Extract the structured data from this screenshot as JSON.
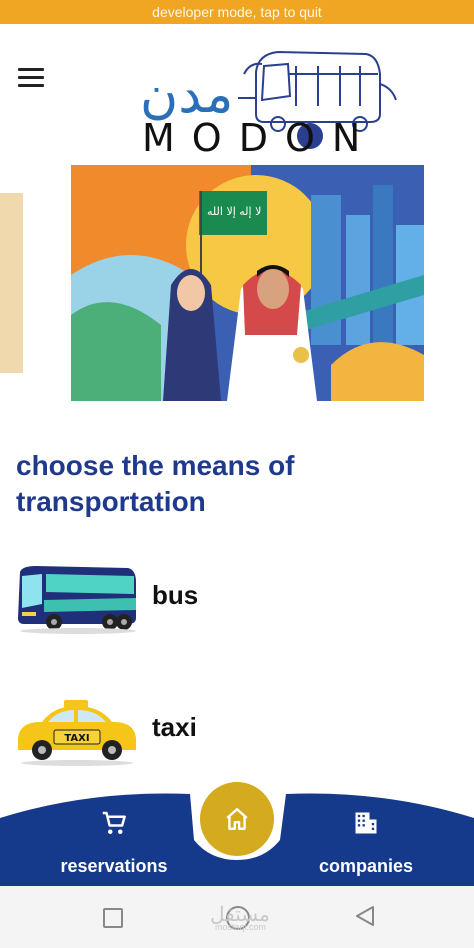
{
  "status_bar": {
    "text": "developer mode, tap to quit"
  },
  "logo": {
    "arabic": "مدن",
    "latin": "MODON"
  },
  "section_title": "choose the means of transportation",
  "options": [
    {
      "label": "bus",
      "icon": "bus-icon"
    },
    {
      "label": "taxi",
      "icon": "taxi-icon",
      "sign": "TAXI"
    }
  ],
  "bottom_nav": {
    "reservations": {
      "label": "reservations",
      "icon": "cart-icon"
    },
    "home": {
      "icon": "home-icon"
    },
    "companies": {
      "label": "companies",
      "icon": "building-icon"
    }
  },
  "watermark": {
    "text": "مستقل",
    "sub": "mostaql.com"
  },
  "colors": {
    "navy": "#15398b",
    "gold": "#d4aa1e",
    "orange": "#f1a623",
    "title": "#1f3a8a"
  }
}
